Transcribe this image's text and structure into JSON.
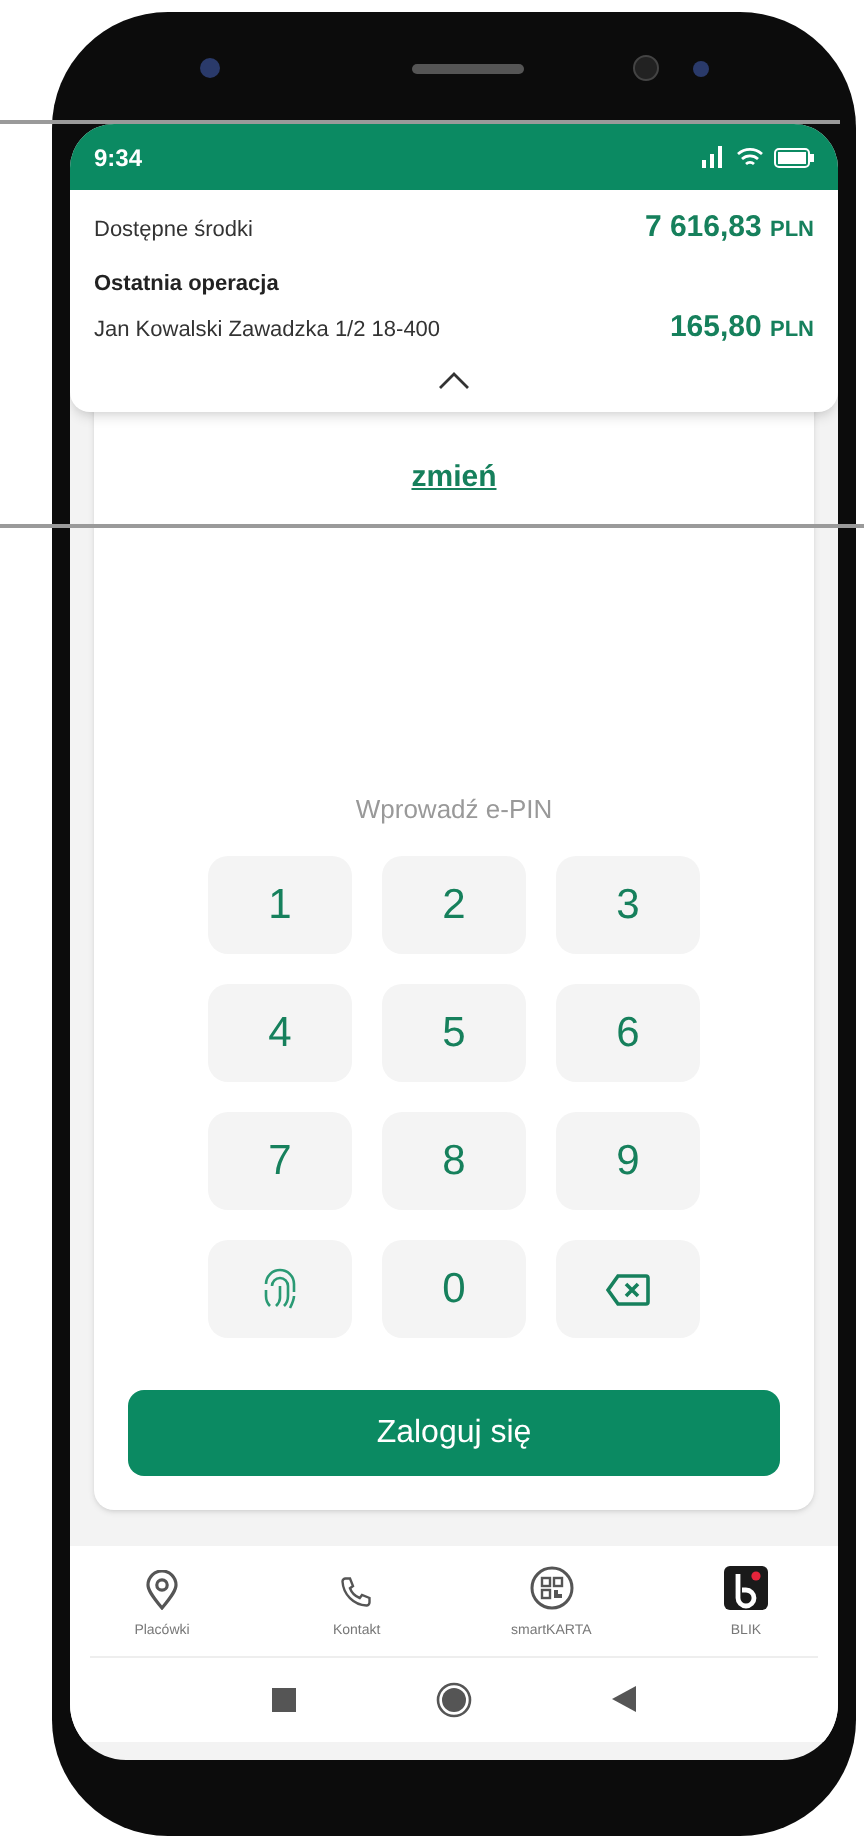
{
  "status_bar": {
    "time": "9:34"
  },
  "summary": {
    "available_label": "Dostępne środki",
    "available_amount": "7 616,83",
    "available_currency": "PLN",
    "last_label": "Ostatnia operacja",
    "last_description": "Jan Kowalski Zawadzka 1/2 18-400",
    "last_amount": "165,80",
    "last_currency": "PLN",
    "expanded": true
  },
  "change_link": "zmień",
  "pin_prompt": "Wprowadź e-PIN",
  "keypad": [
    {
      "kind": "digit",
      "label": "1"
    },
    {
      "kind": "digit",
      "label": "2"
    },
    {
      "kind": "digit",
      "label": "3"
    },
    {
      "kind": "digit",
      "label": "4"
    },
    {
      "kind": "digit",
      "label": "5"
    },
    {
      "kind": "digit",
      "label": "6"
    },
    {
      "kind": "digit",
      "label": "7"
    },
    {
      "kind": "digit",
      "label": "8"
    },
    {
      "kind": "digit",
      "label": "9"
    },
    {
      "kind": "fingerprint"
    },
    {
      "kind": "digit",
      "label": "0"
    },
    {
      "kind": "backspace"
    }
  ],
  "login_button": "Zaloguj się",
  "bottom_nav": [
    {
      "kind": "pin",
      "label": "Placówki"
    },
    {
      "kind": "phone",
      "label": "Kontakt"
    },
    {
      "kind": "qr",
      "label": "smartKARTA"
    },
    {
      "kind": "blik",
      "label": "BLIK"
    }
  ]
}
